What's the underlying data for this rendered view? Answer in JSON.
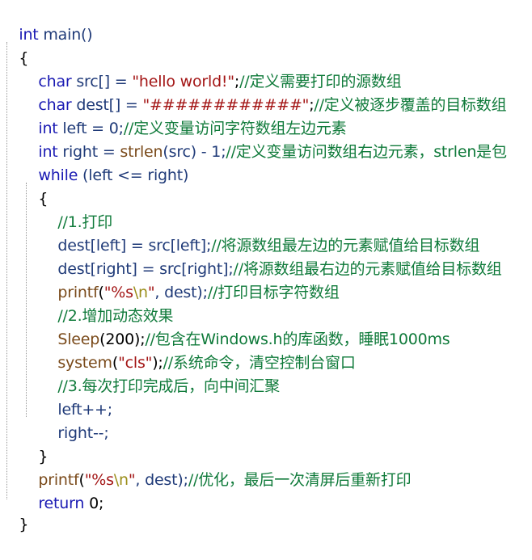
{
  "code": {
    "l0": {
      "t1": "int",
      "t2": " main()"
    },
    "l1": {
      "t1": "{"
    },
    "l2": {
      "t1": "char",
      "t2": " src[] = ",
      "t3": "\"hello world!\"",
      "t4": ";",
      "t5": "//定义需要打印的源数组"
    },
    "l3": {
      "t1": "char",
      "t2": " dest[] = ",
      "t3": "\"############\"",
      "t4": ";",
      "t5": "//定义被逐步覆盖的目标数组"
    },
    "l4": {
      "t1": "int",
      "t2": " left = 0;",
      "t5": "//定义变量访问字符数组左边元素"
    },
    "l5": {
      "t1": "int",
      "t2": " right = ",
      "t3": "strlen",
      "t4": "(src) - 1;",
      "t5": "//定义变量访问数组右边元素，strlen是包"
    },
    "l6": {
      "t1": "while",
      "t2": " (left <= right)"
    },
    "l7": {
      "t1": "{"
    },
    "l8": {
      "t5": "//1.打印"
    },
    "l9": {
      "t2": "dest[left] = src[left];",
      "t5": "//将源数组最左边的元素赋值给目标数组"
    },
    "l10": {
      "t2": "dest[right] = src[right];",
      "t5": "//将源数组最右边的元素赋值给目标数组"
    },
    "l11": {
      "t1": "printf",
      "t2": "(",
      "t3": "\"%s",
      "t3b": "\\n",
      "t3c": "\"",
      "t4": ", dest);",
      "t5": "//打印目标字符数组"
    },
    "l12": {
      "t5": "//2.增加动态效果"
    },
    "l13": {
      "t1": "Sleep",
      "t2": "(200);",
      "t5": "//包含在Windows.h的库函数，睡眠1000ms"
    },
    "l14": {
      "t1": "system",
      "t2": "(",
      "t3": "\"cls\"",
      "t4": ");",
      "t5": "//系统命令，清空控制台窗口"
    },
    "l15": {
      "t5": "//3.每次打印完成后，向中间汇聚"
    },
    "l16": {
      "t2": "left++;"
    },
    "l17": {
      "t2": "right--;"
    },
    "l18": {
      "t1": "}"
    },
    "l19": {
      "t1": "printf",
      "t2": "(",
      "t3": "\"%s",
      "t3b": "\\n",
      "t3c": "\"",
      "t4": ", dest);",
      "t5": "//优化，最后一次清屏后重新打印"
    },
    "l20": {
      "t1": "return",
      "t2": " 0;"
    },
    "l21": {
      "t1": "}"
    }
  }
}
